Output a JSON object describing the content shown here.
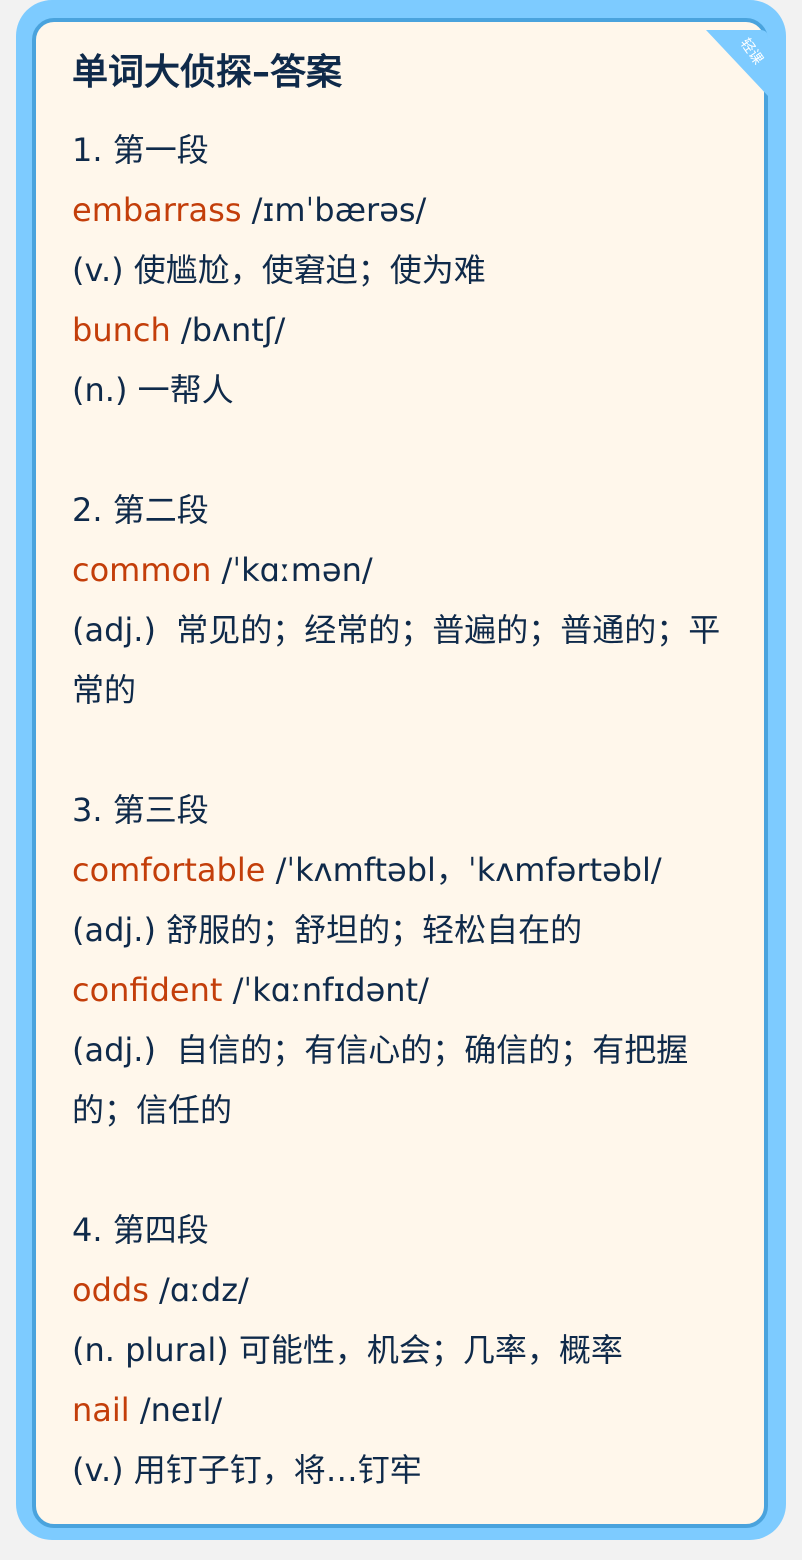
{
  "title": "单词大侦探–答案",
  "badge": "轻课",
  "colors": {
    "outer": "#7dcbff",
    "border": "#4aa3dd",
    "background": "#fff7eb",
    "text": "#0f2a4a",
    "word": "#c33e0a"
  },
  "sections": [
    {
      "heading": "1. 第一段",
      "entries": [
        {
          "word": "embarrass",
          "phonetic": "/ɪmˈbærəs/",
          "definition": "(v.) 使尴尬，使窘迫；使为难"
        },
        {
          "word": "bunch",
          "phonetic": "/bʌntʃ/",
          "definition": "(n.) 一帮人"
        }
      ]
    },
    {
      "heading": "2. 第二段",
      "entries": [
        {
          "word": "common",
          "phonetic": "/ˈkɑːmən/",
          "definition": "(adj.)  常见的；经常的；普遍的；普通的；平常的"
        }
      ]
    },
    {
      "heading": "3. 第三段",
      "entries": [
        {
          "word": "comfortable",
          "phonetic": "/ˈkʌmftəbl，ˈkʌmfərtəbl/",
          "definition": "(adj.) 舒服的；舒坦的；轻松自在的"
        },
        {
          "word": "confident",
          "phonetic": "/ˈkɑːnfɪdənt/",
          "definition": "(adj.)  自信的；有信心的；确信的；有把握的；信任的"
        }
      ]
    },
    {
      "heading": "4. 第四段",
      "entries": [
        {
          "word": "odds",
          "phonetic": "/ɑːdz/",
          "definition": "(n. plural) 可能性，机会；几率，概率"
        },
        {
          "word": "nail",
          "phonetic": "/neɪl/",
          "definition": "(v.) 用钉子钉，将…钉牢"
        }
      ]
    }
  ]
}
